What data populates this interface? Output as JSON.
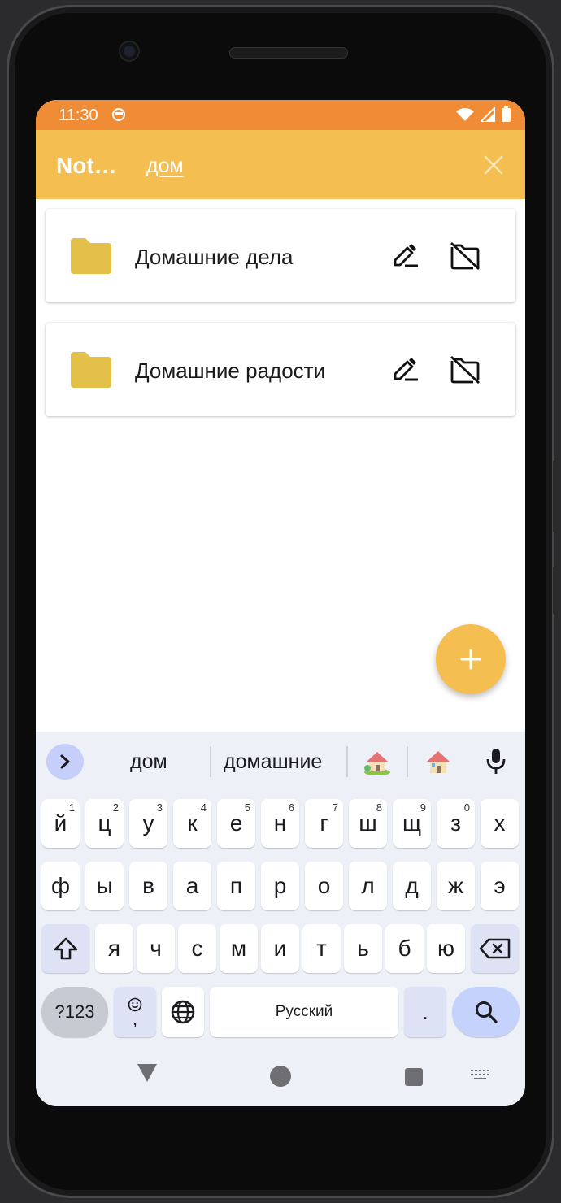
{
  "status_bar": {
    "time": "11:30"
  },
  "app_bar": {
    "title": "Not…",
    "search_query": "дом"
  },
  "folders": [
    {
      "name": "Домашние дела"
    },
    {
      "name": "Домашние радости"
    }
  ],
  "keyboard": {
    "suggestions": [
      "дом",
      "домашние"
    ],
    "row1": [
      {
        "k": "й",
        "h": "1"
      },
      {
        "k": "ц",
        "h": "2"
      },
      {
        "k": "у",
        "h": "3"
      },
      {
        "k": "к",
        "h": "4"
      },
      {
        "k": "е",
        "h": "5"
      },
      {
        "k": "н",
        "h": "6"
      },
      {
        "k": "г",
        "h": "7"
      },
      {
        "k": "ш",
        "h": "8"
      },
      {
        "k": "щ",
        "h": "9"
      },
      {
        "k": "з",
        "h": "0"
      },
      {
        "k": "х",
        "h": ""
      }
    ],
    "row2": [
      "ф",
      "ы",
      "в",
      "а",
      "п",
      "р",
      "о",
      "л",
      "д",
      "ж",
      "э"
    ],
    "row3": [
      "я",
      "ч",
      "с",
      "м",
      "и",
      "т",
      "ь",
      "б",
      "ю"
    ],
    "symbols_label": "?123",
    "emoji_comma": ",",
    "space_label": "Русский",
    "period_label": "."
  },
  "colors": {
    "status_bar": "#f08c36",
    "app_bar": "#f4be50",
    "folder_icon": "#e2c04a",
    "fab": "#f4be50",
    "keyboard_bg": "#eef0f7"
  }
}
